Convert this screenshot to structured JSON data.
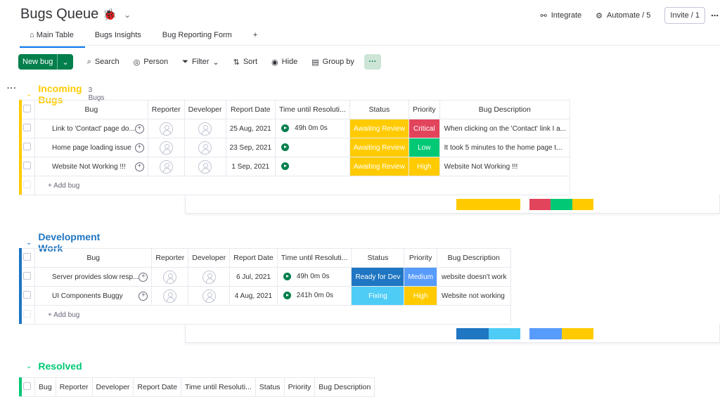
{
  "board": {
    "title": "Bugs Queue",
    "emoji": "🐞"
  },
  "header": {
    "integrate": "Integrate",
    "automate": "Automate / 5",
    "invite": "Invite / 1",
    "more": "⋯"
  },
  "tabs": [
    "Main Table",
    "Bugs Insights",
    "Bug Reporting Form",
    "+"
  ],
  "toolbar": {
    "new": "New bug",
    "search": "Search",
    "person": "Person",
    "filter": "Filter",
    "sort": "Sort",
    "hide": "Hide",
    "group_by": "Group by",
    "more": "···"
  },
  "columns": [
    "Bug",
    "Reporter",
    "Developer",
    "Report Date",
    "Time until Resoluti...",
    "Status",
    "Priority",
    "Bug Description"
  ],
  "add_label": "+ Add bug",
  "colors": {
    "green": "#037f4c",
    "yellow": "#ffcb00",
    "red": "#e2445c",
    "lightgreen": "#00c875",
    "blue": "#1f76c2",
    "fixing": "#4eccf6",
    "medium": "#579bfc",
    "dev": "#0086c0"
  },
  "groups": [
    {
      "title": "Incoming Bugs",
      "count": "3 Bugs",
      "color": "#ffcb00",
      "rows": [
        {
          "bug": "Link to 'Contact' page do...",
          "date": "25 Aug, 2021",
          "time": "49h 0m 0s",
          "status": "Awaiting Review",
          "priority": "Critical",
          "description": "When clicking on the 'Contact' link I a..."
        },
        {
          "bug": "Home page loading issue",
          "date": "23 Sep, 2021",
          "time": "",
          "status": "Awaiting Review",
          "priority": "Low",
          "description": "It took 5 minutes to the home page t..."
        },
        {
          "bug": "Website Not Working !!!",
          "date": "1 Sep, 2021",
          "time": "",
          "status": "Awaiting Review",
          "priority": "High",
          "description": "Website Not Working !!!"
        }
      ]
    },
    {
      "title": "Development Work",
      "count": "",
      "color": "#1f76c2",
      "rows": [
        {
          "bug": "Server provides slow resp...",
          "date": "6 Jul, 2021",
          "time": "49h 0m 0s",
          "status": "Ready for Dev",
          "priority": "Medium",
          "description": "website doesn't work"
        },
        {
          "bug": "UI Components Buggy",
          "date": "4 Aug, 2021",
          "time": "241h 0m 0s",
          "status": "Fixing",
          "priority": "High",
          "description": "Website not working"
        }
      ]
    },
    {
      "title": "Resolved",
      "count": "",
      "color": "#00c875",
      "rows": []
    }
  ]
}
